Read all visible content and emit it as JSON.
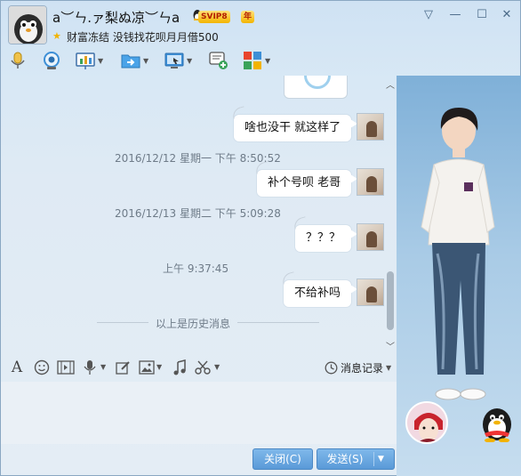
{
  "header": {
    "nickname": "a︶ㄣ.ァ梨ぬ凉︶ㄣa",
    "vip_label": "SVIP8",
    "year_label": "年",
    "signature": "财富冻结 没钱找花呗月月借500"
  },
  "window_controls": {
    "menu": "▽",
    "minimize": "—",
    "maximize": "☐",
    "close": "✕"
  },
  "toolbar": {
    "items": [
      {
        "name": "voice-call",
        "icon": "microphone-icon",
        "has_menu": false
      },
      {
        "name": "video-call",
        "icon": "webcam-icon",
        "has_menu": false
      },
      {
        "name": "remote-desktop",
        "icon": "presentation-icon",
        "has_menu": true
      },
      {
        "name": "send-file",
        "icon": "folder-arrow-icon",
        "has_menu": true
      },
      {
        "name": "screen-share",
        "icon": "monitor-icon",
        "has_menu": true
      },
      {
        "name": "create-discussion",
        "icon": "chat-add-icon",
        "has_menu": false
      },
      {
        "name": "apps",
        "icon": "apps-grid-icon",
        "has_menu": true
      }
    ]
  },
  "chat": {
    "messages": [
      {
        "type": "bubble",
        "text": "啥也没干 就这样了"
      },
      {
        "type": "timestamp",
        "text": "2016/12/12 星期一 下午 8:50:52"
      },
      {
        "type": "bubble",
        "text": "补个号呗 老哥"
      },
      {
        "type": "timestamp",
        "text": "2016/12/13 星期二 下午 5:09:28"
      },
      {
        "type": "bubble",
        "text": "？？？"
      },
      {
        "type": "timestamp",
        "text": "上午 9:37:45"
      },
      {
        "type": "bubble",
        "text": "不给补吗"
      }
    ],
    "history_divider": "以上是历史消息"
  },
  "input_toolbar": {
    "message_record": "消息记录",
    "icons": [
      "font-icon",
      "emoji-icon",
      "gif-icon",
      "voice-message-icon",
      "edit-icon",
      "image-icon",
      "music-icon",
      "scissors-icon"
    ]
  },
  "buttons": {
    "close": "关闭(C)",
    "send": "发送(S)"
  },
  "colors": {
    "accent": "#5a9ad8",
    "vip_gold": "#f3b400",
    "timestamp": "#6e7b88"
  }
}
